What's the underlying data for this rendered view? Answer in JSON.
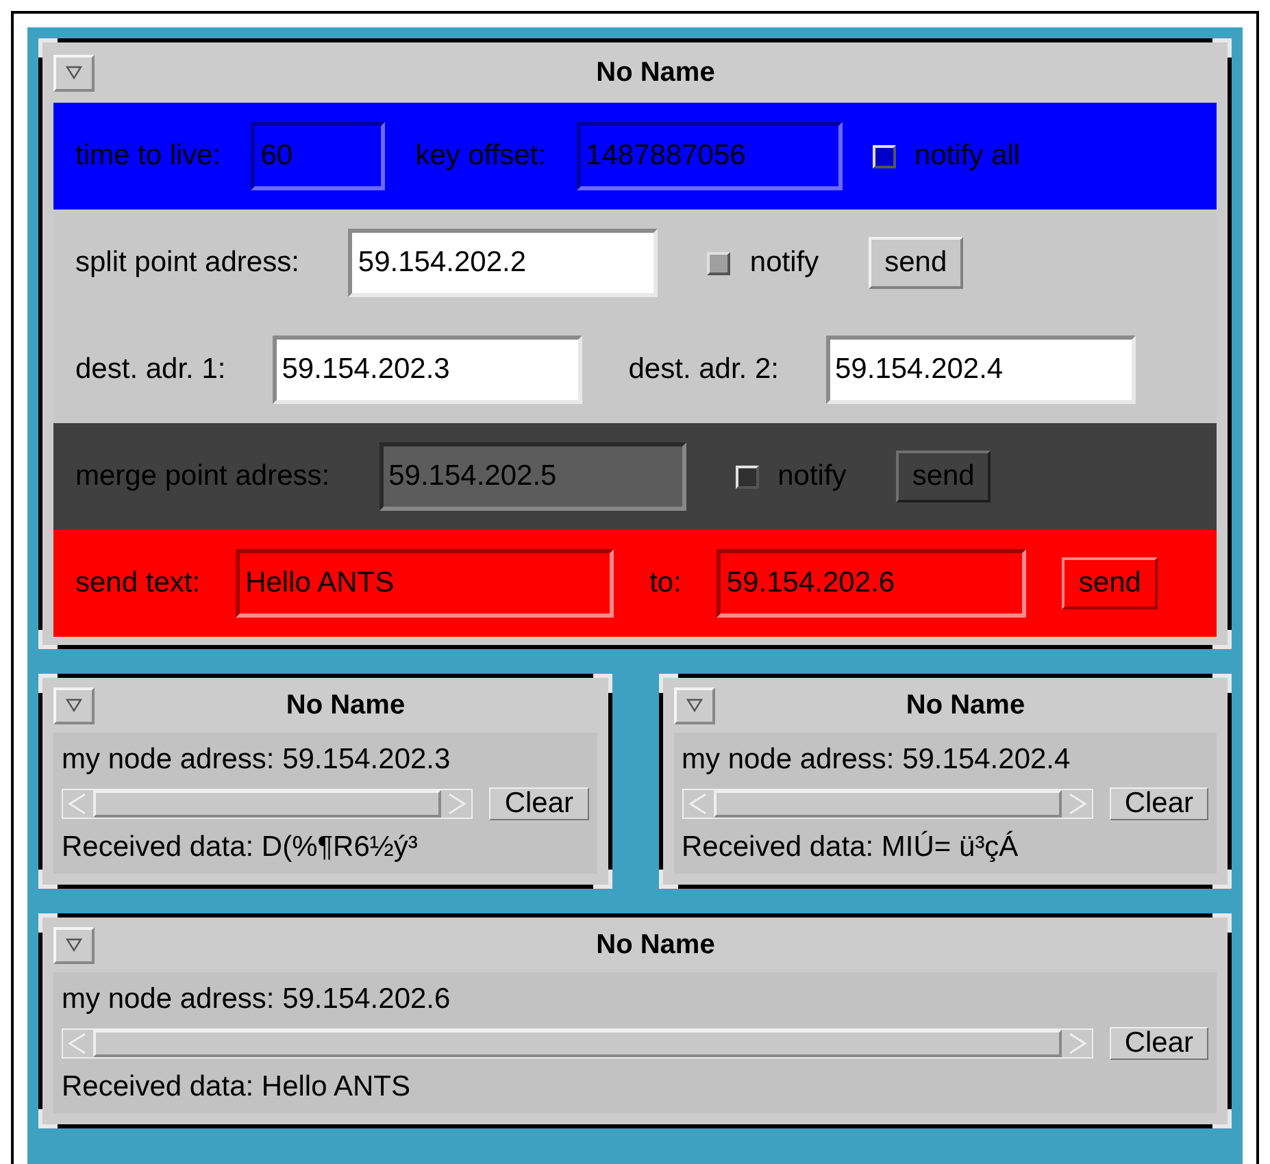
{
  "main_window": {
    "title": "No Name",
    "rows": [
      {
        "kind": "blue",
        "items": [
          {
            "kind": "label",
            "text": "time to live:"
          },
          {
            "kind": "field",
            "value": "60"
          },
          {
            "kind": "label",
            "text": "key offset:"
          },
          {
            "kind": "field",
            "value": "1487887056"
          },
          {
            "kind": "checkbox",
            "text": "notify all",
            "checked": false
          }
        ]
      },
      {
        "kind": "plain",
        "items": [
          {
            "kind": "label",
            "text": "split point adress:"
          },
          {
            "kind": "field",
            "value": "59.154.202.2"
          },
          {
            "kind": "checkbox",
            "text": "notify",
            "checked": false
          },
          {
            "kind": "button",
            "text": "send"
          }
        ]
      },
      {
        "kind": "plain",
        "items": [
          {
            "kind": "label",
            "text": "dest. adr. 1:"
          },
          {
            "kind": "field",
            "value": "59.154.202.3"
          },
          {
            "kind": "label",
            "text": "dest. adr. 2:"
          },
          {
            "kind": "field",
            "value": "59.154.202.4"
          }
        ]
      },
      {
        "kind": "dark",
        "items": [
          {
            "kind": "label",
            "text": "merge point adress:"
          },
          {
            "kind": "field",
            "value": "59.154.202.5"
          },
          {
            "kind": "checkbox",
            "text": "notify",
            "checked": false
          },
          {
            "kind": "button",
            "text": "send"
          }
        ]
      },
      {
        "kind": "red",
        "items": [
          {
            "kind": "label",
            "text": "send text:"
          },
          {
            "kind": "field",
            "value": "Hello ANTS"
          },
          {
            "kind": "label",
            "text": "to:"
          },
          {
            "kind": "field",
            "value": "59.154.202.6"
          },
          {
            "kind": "button",
            "text": "send"
          }
        ]
      }
    ]
  },
  "node_windows": [
    {
      "title": "No Name",
      "address": "my node adress: 59.154.202.3",
      "clear_button": "Clear",
      "received": "Received data: D(%¶R6½ý³"
    },
    {
      "title": "No Name",
      "address": "my node adress: 59.154.202.4",
      "clear_button": "Clear",
      "received": "Received data:  MIÚ= ü³çÁ"
    },
    {
      "title": "No Name",
      "address": "my node adress: 59.154.202.6",
      "clear_button": "Clear",
      "received": "Received data: Hello ANTS"
    }
  ]
}
